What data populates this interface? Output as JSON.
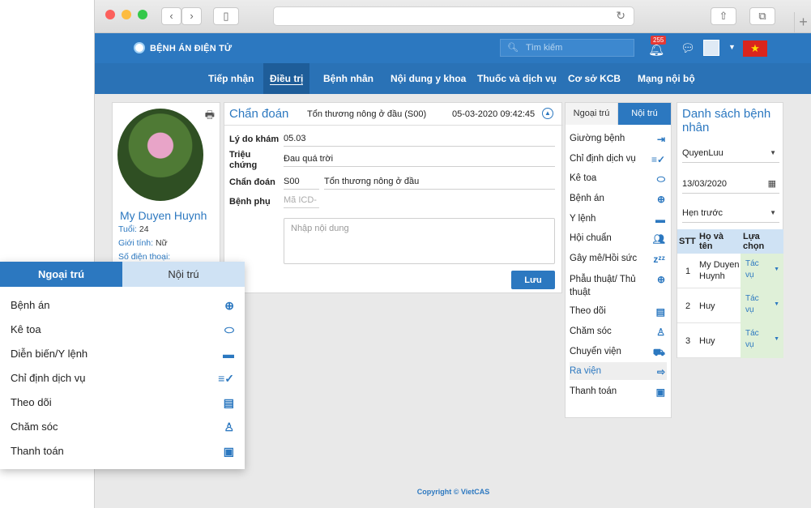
{
  "browser": {
    "dots": [
      "#fc605c",
      "#fdbc40",
      "#34c84a"
    ],
    "back_icon": "‹",
    "forward_icon": "›",
    "sidebar_icon": "▯",
    "reload_icon": "↻",
    "share_icon": "⇧",
    "tabs_icon": "⧉",
    "new_tab_icon": "+"
  },
  "header": {
    "brand": "BỆNH ÁN ĐIỆN TỬ",
    "search_placeholder": "Tìm kiếm",
    "notification_count": "255",
    "colors": {
      "primary": "#2c78c0",
      "nav": "#2a72b6",
      "flag": "#da251d"
    }
  },
  "nav": {
    "items": [
      "Tiếp nhận",
      "Điều trị",
      "Bệnh nhân",
      "Nội dung y khoa",
      "Thuốc và dịch vụ",
      "Cơ sở KCB",
      "Mạng nội bộ"
    ],
    "active": "Điều trị"
  },
  "profile": {
    "name": "My Duyen Huynh",
    "age_label": "Tuổi:",
    "age": "24",
    "gender_label": "Giới tính:",
    "gender": "Nữ",
    "phone_label": "Số điện thoại:"
  },
  "diagnosis": {
    "title": "Chẩn đoán",
    "summary": "Tổn thương nông ở đầu (S00)",
    "datetime": "05-03-2020 09:42:45",
    "reason_label": "Lý do khám",
    "reason": "05.03",
    "symptom_label_1": "Triệu",
    "symptom_label_2": "chứng",
    "symptom": "Đau quá trời",
    "diag_label": "Chẩn đoán",
    "diag_code": "S00",
    "diag_name": "Tổn thương nông ở đầu",
    "secondary_label": "Bệnh phụ",
    "secondary_placeholder": "Mã ICD-",
    "content_placeholder": "Nhập nội dung",
    "save": "Lưu"
  },
  "menu": {
    "tabs": [
      "Ngoại trú",
      "Nội trú"
    ],
    "active_tab": "Nội trú",
    "items": [
      {
        "label": "Giường bệnh",
        "icon": "enter-icon"
      },
      {
        "label": "Chỉ định dịch vụ",
        "icon": "checklist-icon"
      },
      {
        "label": "Kê toa",
        "icon": "pill-icon"
      },
      {
        "label": "Bệnh án",
        "icon": "plus-circle-icon"
      },
      {
        "label": "Y lệnh",
        "icon": "bed-icon"
      },
      {
        "label": "Hội chuẩn",
        "icon": "group-icon"
      },
      {
        "label": "Gây mê/Hồi sức",
        "icon": "sleep-icon"
      },
      {
        "label": "Phẫu thuật/ Thủ",
        "label2": "thuật",
        "icon": "plus-circle-icon"
      },
      {
        "label": "Theo dõi",
        "icon": "clipboard-icon"
      },
      {
        "label": "Chăm sóc",
        "icon": "nurse-icon"
      },
      {
        "label": "Chuyển viện",
        "icon": "ambulance-icon"
      },
      {
        "label": "Ra viện",
        "icon": "exit-icon"
      },
      {
        "label": "Thanh toán",
        "icon": "money-icon"
      }
    ],
    "highlighted": "Ra viện"
  },
  "patients": {
    "title": "Danh sách bệnh nhân",
    "doctor": "QuyenLuu",
    "date": "13/03/2020",
    "filter": "Hẹn trước",
    "columns": [
      "STT",
      "Họ và tên",
      "Lựa chọn"
    ],
    "rows": [
      {
        "stt": "1",
        "name": "My Duyen Huynh",
        "action": "Tác vụ"
      },
      {
        "stt": "2",
        "name": "Huy",
        "action": "Tác vụ"
      },
      {
        "stt": "3",
        "name": "Huy",
        "action": "Tác vụ"
      }
    ]
  },
  "footer": "Copyright © VietCAS",
  "overlay": {
    "tabs": [
      "Ngoại trú",
      "Nội trú"
    ],
    "active_tab": "Ngoại trú",
    "items": [
      {
        "label": "Bệnh án",
        "icon": "plus-circle-icon"
      },
      {
        "label": "Kê toa",
        "icon": "pill-icon"
      },
      {
        "label": "Diễn biến/Y lệnh",
        "icon": "bed-icon"
      },
      {
        "label": "Chỉ định dịch vụ",
        "icon": "checklist-icon"
      },
      {
        "label": "Theo dõi",
        "icon": "clipboard-icon"
      },
      {
        "label": "Chăm sóc",
        "icon": "nurse-icon"
      },
      {
        "label": "Thanh toán",
        "icon": "money-icon"
      }
    ]
  }
}
